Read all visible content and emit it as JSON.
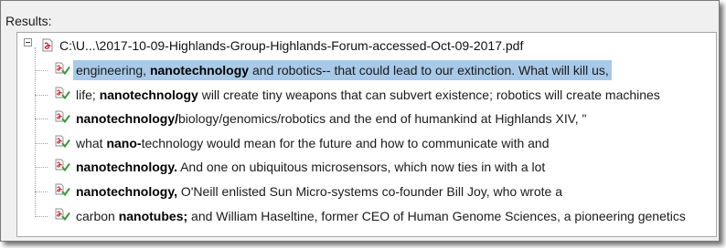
{
  "results_label": "Results:",
  "file": {
    "name": "C:\\U...\\2017-10-09-Highlands-Group-Highlands-Forum-accessed-Oct-09-2017.pdf",
    "icon": "pdf-file-icon"
  },
  "hits": [
    {
      "pre": "engineering, ",
      "bold": "nanotechnology",
      "post": " and robotics-- that could lead to our extinction. What will kill us,",
      "selected": true
    },
    {
      "pre": "life; ",
      "bold": "nanotechnology",
      "post": " will create tiny weapons that can subvert existence; robotics will create machines",
      "selected": false
    },
    {
      "pre": "",
      "bold": "nanotechnology/",
      "post": "biology/genomics/robotics and the end of humankind at Highlands XIV, \"",
      "selected": false
    },
    {
      "pre": "what ",
      "bold": "nano-",
      "post": "technology would mean for the future and how to communicate with and",
      "selected": false
    },
    {
      "pre": "",
      "bold": "nanotechnology.",
      "post": " And one on ubiquitous microsensors, which now ties in with a lot",
      "selected": false
    },
    {
      "pre": "",
      "bold": "nanotechnology,",
      "post": " O'Neill enlisted Sun Micro-systems co-founder Bill Joy, who wrote a",
      "selected": false
    },
    {
      "pre": "carbon ",
      "bold": "nanotubes;",
      "post": " and William Haseltine, former CEO of Human Genome Sciences, a pioneering genetics",
      "selected": false
    }
  ],
  "colors": {
    "selection": "#a8c9e8",
    "pdf_red": "#c8202a",
    "hit_green": "#3a9a3a"
  }
}
